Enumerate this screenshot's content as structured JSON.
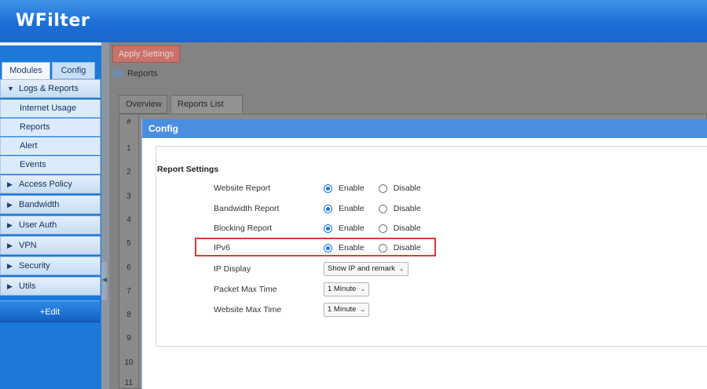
{
  "app": {
    "brand": "WFilter"
  },
  "sidebar": {
    "tabs": [
      {
        "label": "Modules"
      },
      {
        "label": "Config"
      }
    ],
    "sections": [
      {
        "label": "Logs & Reports",
        "expanded": true,
        "items": [
          {
            "label": "Internet Usage"
          },
          {
            "label": "Reports"
          },
          {
            "label": "Alert"
          },
          {
            "label": "Events"
          }
        ]
      },
      {
        "label": "Access Policy"
      },
      {
        "label": "Bandwidth"
      },
      {
        "label": "User Auth"
      },
      {
        "label": "VPN"
      },
      {
        "label": "Security"
      },
      {
        "label": "Utils"
      }
    ],
    "edit_label": "+Edit"
  },
  "main": {
    "apply_label": "Apply Settings",
    "breadcrumb": "Reports",
    "tabs": [
      {
        "label": "Overview"
      },
      {
        "label": "Reports  List"
      }
    ],
    "table_header": "#",
    "row_numbers": [
      "1",
      "2",
      "3",
      "4",
      "5",
      "6",
      "7",
      "8",
      "9",
      "10",
      "11"
    ]
  },
  "modal": {
    "title": "Config",
    "section_title": "Report  Settings",
    "rows": [
      {
        "label": "Website  Report",
        "enable": "Enable",
        "disable": "Disable",
        "selected": "Enable"
      },
      {
        "label": "Bandwidth  Report",
        "enable": "Enable",
        "disable": "Disable",
        "selected": "Enable"
      },
      {
        "label": "Blocking  Report",
        "enable": "Enable",
        "disable": "Disable",
        "selected": "Enable"
      },
      {
        "label": "IPv6",
        "enable": "Enable",
        "disable": "Disable",
        "selected": "Enable"
      }
    ],
    "ip_display": {
      "label": "IP  Display",
      "value": "Show IP and remark"
    },
    "packet_max_time": {
      "label": "Packet  Max  Time",
      "value": "1 Minute"
    },
    "website_max_time": {
      "label": "Website  Max  Time",
      "value": "1 Minute"
    }
  },
  "colors": {
    "header": "#1d6fd6",
    "highlight": "#e0393a",
    "radio": "#1a73e8"
  }
}
